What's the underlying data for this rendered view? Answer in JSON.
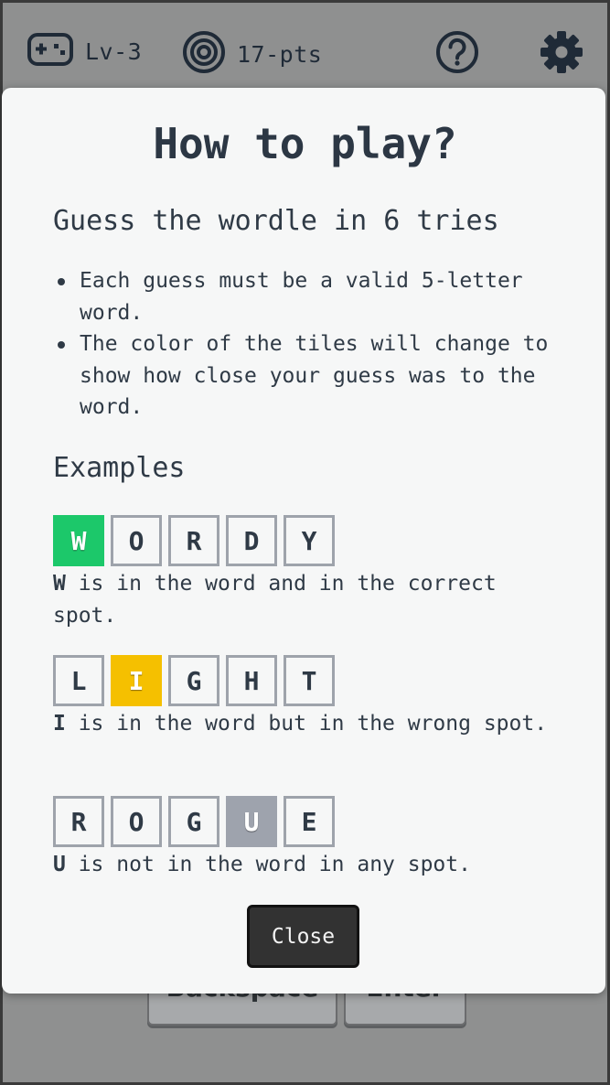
{
  "topbar": {
    "level_label": "Lv-3",
    "points_label": "17-pts",
    "icons": [
      "gamepad-icon",
      "target-icon",
      "help-icon",
      "gear-icon"
    ]
  },
  "keyboard": {
    "backspace_label": "Backspace",
    "enter_label": "Enter"
  },
  "modal": {
    "title": "How to play?",
    "subtitle": "Guess the wordle in 6 tries",
    "rules": [
      "Each guess must be a valid 5-letter word.",
      "The color of the tiles will change to show how close your guess was to the word."
    ],
    "examples_title": "Examples",
    "examples": [
      {
        "letters": [
          "W",
          "O",
          "R",
          "D",
          "Y"
        ],
        "highlight_index": 0,
        "highlight_state": "correct",
        "desc_letter": "W",
        "desc_text": " is in the word and in the correct spot."
      },
      {
        "letters": [
          "L",
          "I",
          "G",
          "H",
          "T"
        ],
        "highlight_index": 1,
        "highlight_state": "present",
        "desc_letter": "I",
        "desc_text": " is in the word but in the wrong spot."
      },
      {
        "letters": [
          "R",
          "O",
          "G",
          "U",
          "E"
        ],
        "highlight_index": 3,
        "highlight_state": "absent",
        "desc_letter": "U",
        "desc_text": " is not in the word in any spot."
      }
    ],
    "close_label": "Close"
  },
  "colors": {
    "correct": "#1cc86a",
    "present": "#f5c000",
    "absent": "#9ea3ad",
    "overlay": "#8f9090",
    "text": "#2f3a46"
  }
}
